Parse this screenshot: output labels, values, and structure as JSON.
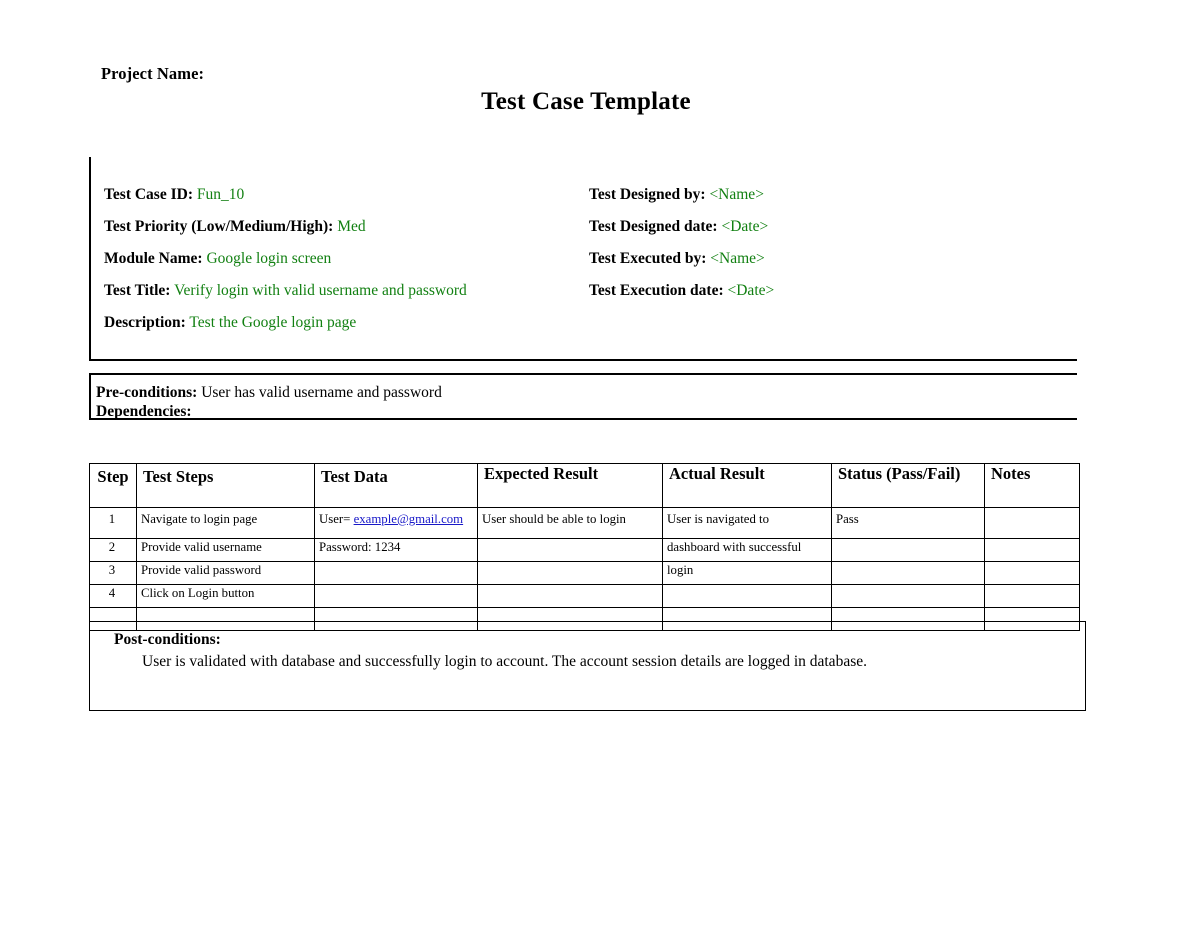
{
  "document": {
    "project_name_label": "Project Name:",
    "title": "Test Case Template"
  },
  "info": {
    "left_fields": [
      {
        "label": "Test Case ID:",
        "value": "Fun_10"
      },
      {
        "label": "Test Priority (Low/Medium/High):",
        "value": "Med"
      },
      {
        "label": "Module Name:",
        "value": "Google login screen"
      },
      {
        "label": "Test Title:",
        "value": "Verify login with valid username and password"
      },
      {
        "label": "Description:",
        "value": "Test the Google login page"
      }
    ],
    "right_fields": [
      {
        "label": "Test Designed by:",
        "value": "<Name>"
      },
      {
        "label": "Test Designed date:",
        "value": "<Date>"
      },
      {
        "label": "Test Executed by:",
        "value": "<Name>"
      },
      {
        "label": "Test Execution date:",
        "value": "<Date>"
      }
    ],
    "value_color": "#128012"
  },
  "preconditions": {
    "label": "Pre-conditions:",
    "value": "User has valid username and password",
    "dependencies_label": "Dependencies:",
    "dependencies_value": ""
  },
  "steps_table": {
    "headers": [
      "Step",
      "Test Steps",
      "Test Data",
      "Expected Result",
      "Actual Result",
      "Status (Pass/Fail)",
      "Notes"
    ],
    "rows": [
      {
        "step": "1",
        "test_steps": "Navigate to login page",
        "test_data_prefix": "User= ",
        "test_data_link": "example@gmail.com",
        "expected_result": "User should be able to login",
        "actual_result": "User is navigated to",
        "status": "Pass",
        "notes": ""
      },
      {
        "step": "2",
        "test_steps": "Provide valid username",
        "test_data_prefix": "Password: 1234",
        "test_data_link": "",
        "expected_result": "",
        "actual_result": "dashboard with successful",
        "status": "",
        "notes": ""
      },
      {
        "step": "3",
        "test_steps": "Provide valid password",
        "test_data_prefix": "",
        "test_data_link": "",
        "expected_result": "",
        "actual_result": "login",
        "status": "",
        "notes": ""
      },
      {
        "step": "4",
        "test_steps": "Click on Login button",
        "test_data_prefix": "",
        "test_data_link": "",
        "expected_result": "",
        "actual_result": "",
        "status": "",
        "notes": ""
      },
      {
        "step": "",
        "test_steps": "",
        "test_data_prefix": "",
        "test_data_link": "",
        "expected_result": "",
        "actual_result": "",
        "status": "",
        "notes": ""
      }
    ],
    "link_color": "#1818c8"
  },
  "postconditions": {
    "label": "Post-conditions:",
    "text": "User is validated with database and successfully login to account. The account session details are logged in database."
  }
}
